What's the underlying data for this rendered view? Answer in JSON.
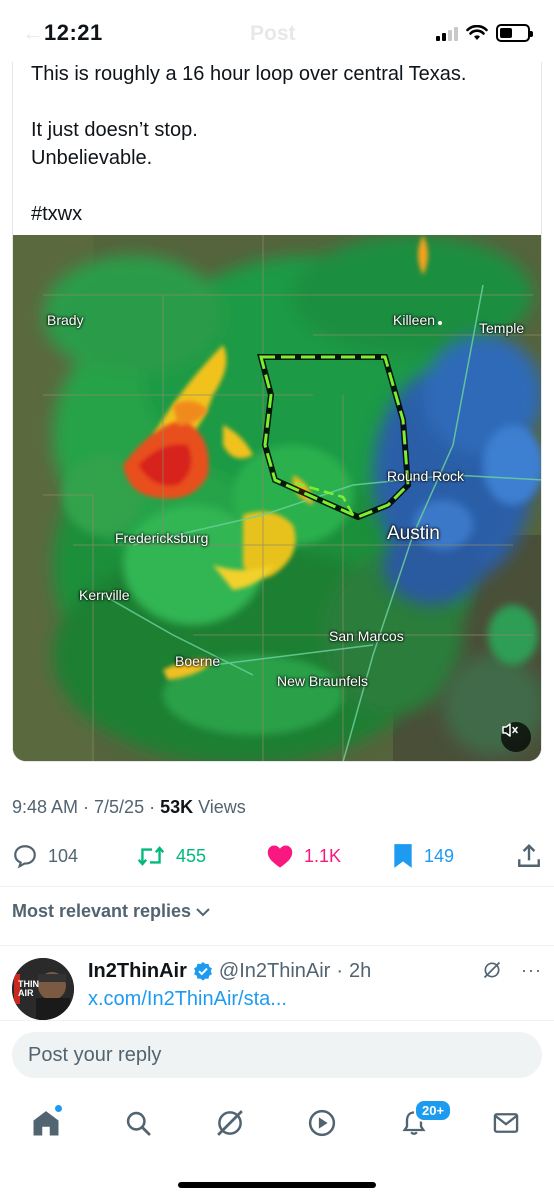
{
  "status_bar": {
    "time": "12:21",
    "header_title": "Post"
  },
  "post": {
    "text_lines": [
      "This is roughly a 16 hour loop over central Texas.",
      "It just doesn’t stop.",
      "Unbelievable.",
      "#txwx"
    ],
    "map_labels": {
      "brady": "Brady",
      "killeen": "Killeen",
      "temple": "Temple",
      "round_rock": "Round Rock",
      "austin": "Austin",
      "fredericksburg": "Fredericksburg",
      "kerrville": "Kerrville",
      "san_marcos": "San Marcos",
      "boerne": "Boerne",
      "new_braunfels": "New Braunfels"
    },
    "timestamp": "9:48 AM · 7/5/25 · ",
    "views_count": "53K",
    "views_label": " Views"
  },
  "actions": {
    "replies": "104",
    "reposts": "455",
    "likes": "1.1K",
    "bookmarks": "149"
  },
  "replies_section": {
    "sort_label": "Most relevant replies"
  },
  "reply": {
    "name": "In2ThinAir",
    "handle": "@In2ThinAir",
    "time": "2h",
    "link": "x.com/In2ThinAir/sta...",
    "avatar_text": "THIN AIR",
    "more": "···"
  },
  "compose": {
    "placeholder": "Post your reply"
  },
  "tabbar": {
    "notif_badge": "20+"
  },
  "colors": {
    "accent": "#1d9bf0",
    "repost": "#00ba7c",
    "like": "#f91880",
    "muted": "#536471"
  }
}
